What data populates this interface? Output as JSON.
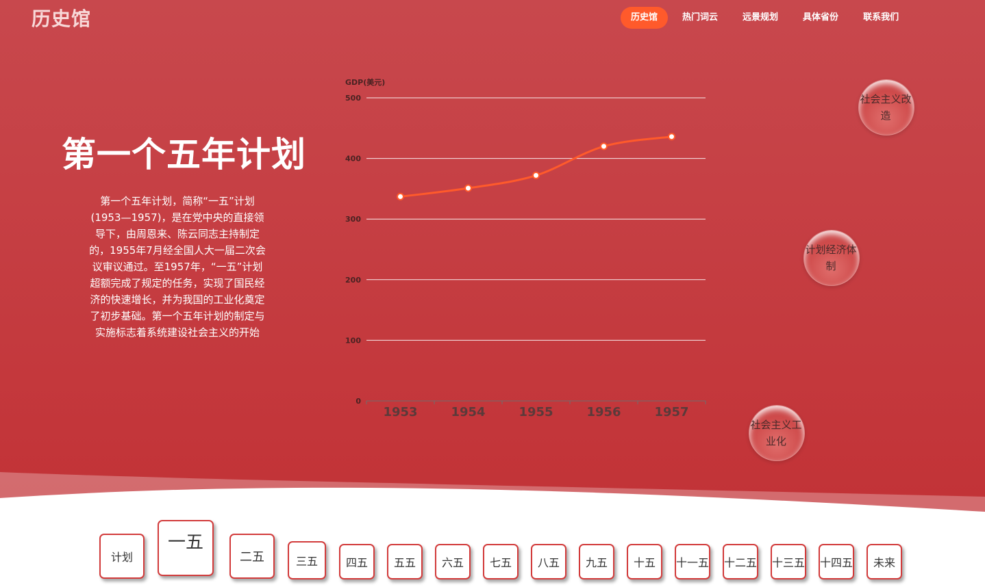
{
  "header": {
    "logo": "历史馆",
    "nav": [
      "历史馆",
      "热门词云",
      "远景规划",
      "具体省份",
      "联系我们"
    ],
    "active_index": 0
  },
  "hero": {
    "title": "第一个五年计划",
    "description": "第一个五年计划，简称“一五”计划(1953—1957)，是在党中央的直接领导下，由周恩来、陈云同志主持制定的，1955年7月经全国人大一届二次会议审议通过。至1957年，“一五”计划超额完成了规定的任务，实现了国民经济的快速增长，并为我国的工业化奠定了初步基础。第一个五年计划的制定与实施标志着系统建设社会主义的开始"
  },
  "chart_data": {
    "type": "line",
    "categories": [
      "1953",
      "1954",
      "1955",
      "1956",
      "1957"
    ],
    "values": [
      337,
      351,
      372,
      420,
      436
    ],
    "ylabel": "GDP(美元)",
    "ylim": [
      0,
      500
    ],
    "yticks": [
      0,
      100,
      200,
      300,
      400,
      500
    ],
    "grid": true,
    "line_color": "#ff5a2b"
  },
  "bubbles": [
    "社会主义改造",
    "计划经济体制",
    "社会主义工业化"
  ],
  "plans": [
    "计划",
    "一五",
    "二五",
    "三五",
    "四五",
    "五五",
    "六五",
    "七五",
    "八五",
    "九五",
    "十五",
    "十一五",
    "十二五",
    "十三五",
    "十四五",
    "未来"
  ],
  "colors": {
    "hero_top": "#c8484d",
    "hero_bottom": "#c23236",
    "accent": "#ff5a2b",
    "button_border": "#d23a3a"
  }
}
